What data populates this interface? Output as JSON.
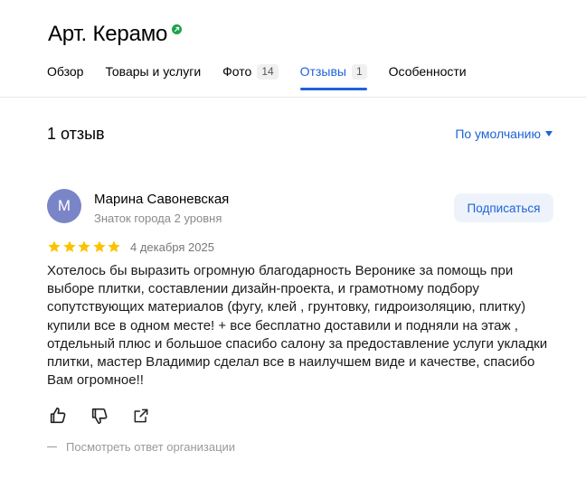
{
  "header": {
    "title": "Арт. Керамо"
  },
  "tabs": [
    {
      "label": "Обзор",
      "count": ""
    },
    {
      "label": "Товары и услуги",
      "count": ""
    },
    {
      "label": "Фото",
      "count": "14"
    },
    {
      "label": "Отзывы",
      "count": "1"
    },
    {
      "label": "Особенности",
      "count": ""
    }
  ],
  "reviews_header": {
    "count_label": "1 отзыв",
    "sort_label": "По умолчанию"
  },
  "review": {
    "avatar_letter": "М",
    "author": "Марина Савоневская",
    "level": "Знаток города 2 уровня",
    "subscribe_label": "Подписаться",
    "rating": 5,
    "date": "4 декабря 2025",
    "text": "Хотелось бы выразить огромную благодарность Веронике за помощь при выборе плитки, составлении дизайн-проекта, и грамотному подбору сопутствующих материалов (фугу, клей , грунтовку, гидроизоляцию, плитку) купили все в одном месте! + все бесплатно доставили и подняли на этаж , отдельный плюс и большое спасибо салону за предоставление услуги укладки плитки, мастер Владимир сделал все в наилучшем виде и качестве, спасибо Вам огромное!!",
    "org_answer_label": "Посмотреть ответ организации"
  },
  "colors": {
    "accent": "#1e63d7",
    "star": "#fcc200",
    "avatar": "#7a85c8",
    "verified": "#1aa34a"
  },
  "icons": [
    "verified-icon",
    "chevron-down-icon",
    "star-icon",
    "thumbs-up-icon",
    "thumbs-down-icon",
    "share-icon"
  ]
}
